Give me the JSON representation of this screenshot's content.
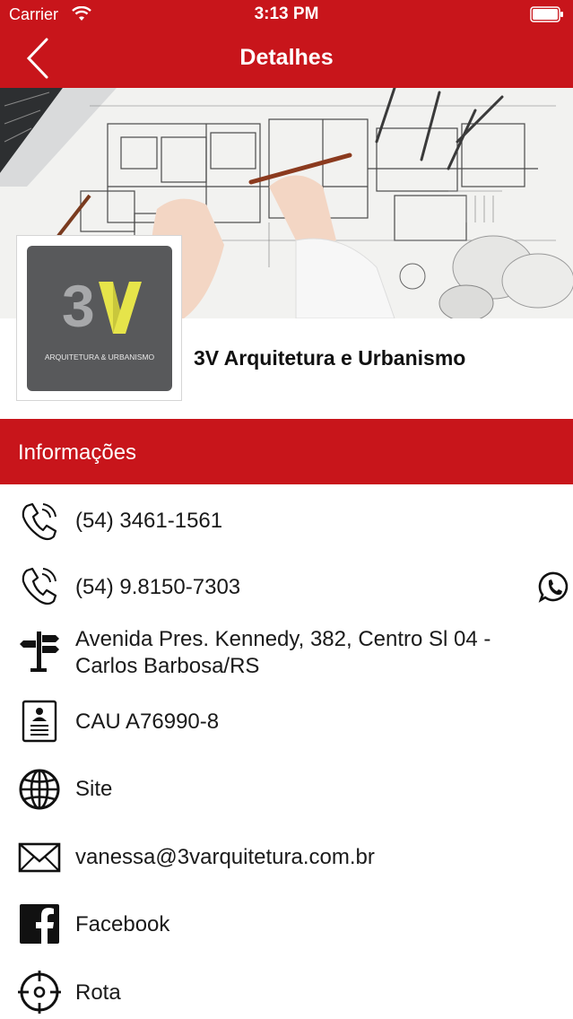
{
  "status_bar": {
    "carrier": "Carrier",
    "time": "3:13 PM"
  },
  "nav": {
    "title": "Detalhes"
  },
  "company": {
    "name": "3V Arquitetura e Urbanismo",
    "logo_mark": "3V",
    "logo_subtitle": "ARQUITETURA & URBANISMO"
  },
  "section": {
    "title": "Informações"
  },
  "info": {
    "phone1": "(54) 3461-1561",
    "phone2": "(54) 9.8150-7303",
    "address_line1": "Avenida Pres. Kennedy, 382, Centro Sl 04 -",
    "address_line2": "Carlos Barbosa/RS",
    "registration": "CAU A76990-8",
    "site": "Site",
    "email": "vanessa@3varquitetura.com.br",
    "facebook": "Facebook",
    "route": "Rota"
  },
  "colors": {
    "brand_red": "#c8151b",
    "logo_bg": "#58595b",
    "logo_yellow": "#e6e44a"
  },
  "icons": [
    "back-chevron-icon",
    "wifi-icon",
    "battery-icon",
    "phone-icon",
    "whatsapp-icon",
    "signpost-icon",
    "id-card-icon",
    "globe-icon",
    "envelope-icon",
    "facebook-icon",
    "crosshair-icon"
  ]
}
